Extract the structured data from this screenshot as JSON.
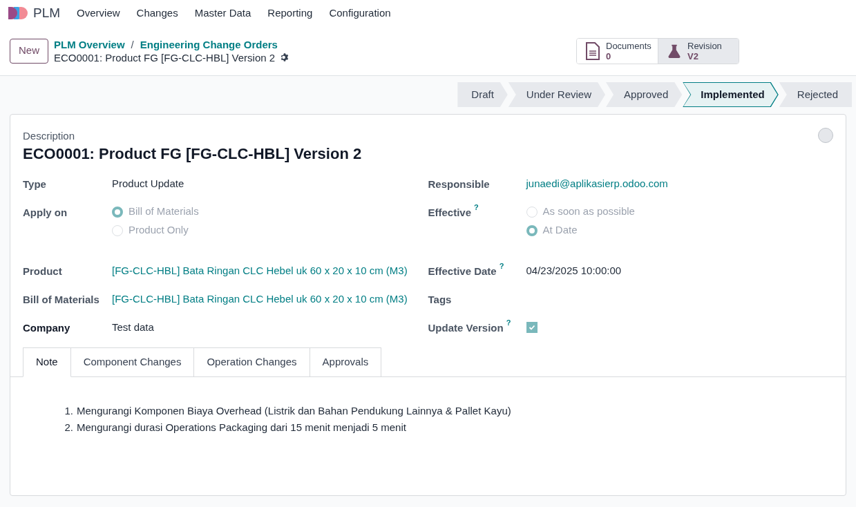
{
  "navbar": {
    "app": "PLM",
    "menu": [
      "Overview",
      "Changes",
      "Master Data",
      "Reporting",
      "Configuration"
    ]
  },
  "control_panel": {
    "new_button": "New",
    "breadcrumbs": [
      "PLM Overview",
      "Engineering Change Orders"
    ],
    "breadcrumb_separator": "/",
    "record": "ECO0001: Product FG [FG-CLC-HBL] Version 2",
    "smart_buttons": [
      {
        "kind": "document",
        "label": "Documents",
        "value": "0",
        "selected": false
      },
      {
        "kind": "flask",
        "label": "Revision",
        "value": "V2",
        "selected": true
      }
    ]
  },
  "statusbar": [
    {
      "label": "Draft",
      "selected": false
    },
    {
      "label": "Under Review",
      "selected": false
    },
    {
      "label": "Approved",
      "selected": false
    },
    {
      "label": "Implemented",
      "selected": true
    },
    {
      "label": "Rejected",
      "selected": false
    }
  ],
  "form": {
    "description_label": "Description",
    "title": "ECO0001: Product FG [FG-CLC-HBL] Version 2",
    "left": [
      {
        "kind": "text",
        "label": "Type",
        "value": "Product Update"
      },
      {
        "kind": "radio",
        "label": "Apply on",
        "options": [
          {
            "label": "Bill of Materials",
            "selected": true
          },
          {
            "label": "Product Only",
            "selected": false
          }
        ]
      },
      {
        "kind": "link",
        "label": "Product",
        "value": "[FG-CLC-HBL] Bata Ringan CLC Hebel uk 60 x 20 x 10 cm (M3)"
      },
      {
        "kind": "link",
        "label": "Bill of Materials",
        "value": "[FG-CLC-HBL] Bata Ringan CLC Hebel uk 60 x 20 x 10 cm (M3)"
      },
      {
        "kind": "text",
        "label": "Company",
        "value": "Test data",
        "required": true
      }
    ],
    "right": [
      {
        "kind": "link",
        "label": "Responsible",
        "value": "junaedi@aplikasierp.odoo.com"
      },
      {
        "kind": "radio",
        "label": "Effective",
        "help": "?",
        "options": [
          {
            "label": "As soon as possible",
            "selected": false
          },
          {
            "label": "At Date",
            "selected": true
          }
        ]
      },
      {
        "kind": "text",
        "label": "Effective Date",
        "help": "?",
        "value": "04/23/2025 10:00:00"
      },
      {
        "kind": "text",
        "label": "Tags"
      },
      {
        "kind": "checkbox",
        "label": "Update Version",
        "help": "?",
        "checked": true
      }
    ],
    "tabs": [
      {
        "label": "Note",
        "selected": true
      },
      {
        "label": "Component Changes",
        "selected": false
      },
      {
        "label": "Operation Changes",
        "selected": false
      },
      {
        "label": "Approvals",
        "selected": false
      }
    ],
    "note": [
      {
        "number": "1.",
        "text": "Mengurangi Komponen Biaya Overhead (Listrik dan Bahan Pendukung Lainnya & Pallet Kayu)"
      },
      {
        "number": "2.",
        "text": "Mengurangi durasi Operations Packaging dari 15 menit menjadi 5 menit"
      }
    ]
  }
}
